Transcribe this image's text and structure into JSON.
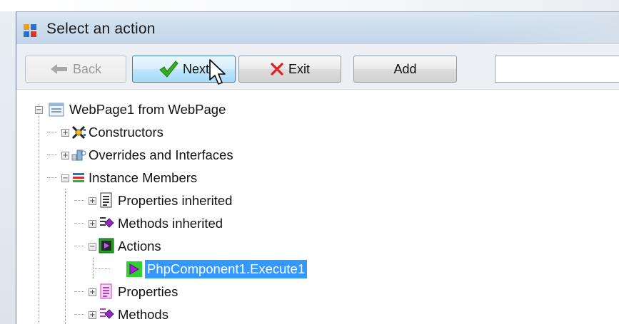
{
  "window": {
    "title": "Select an action"
  },
  "toolbar": {
    "back_label": "Back",
    "next_label": "Next",
    "exit_label": "Exit",
    "add_label": "Add",
    "input_value": ""
  },
  "tree": {
    "root": "WebPage1 from WebPage",
    "constructors": "Constructors",
    "overrides": "Overrides and Interfaces",
    "instance_members": "Instance Members",
    "properties_inherited": "Properties inherited",
    "methods_inherited": "Methods inherited",
    "actions": "Actions",
    "selected_action": "PhpComponent1.Execute1",
    "properties": "Properties",
    "methods": "Methods"
  },
  "colors": {
    "selection": "#3399ff",
    "next_button": "#bee6fd"
  }
}
